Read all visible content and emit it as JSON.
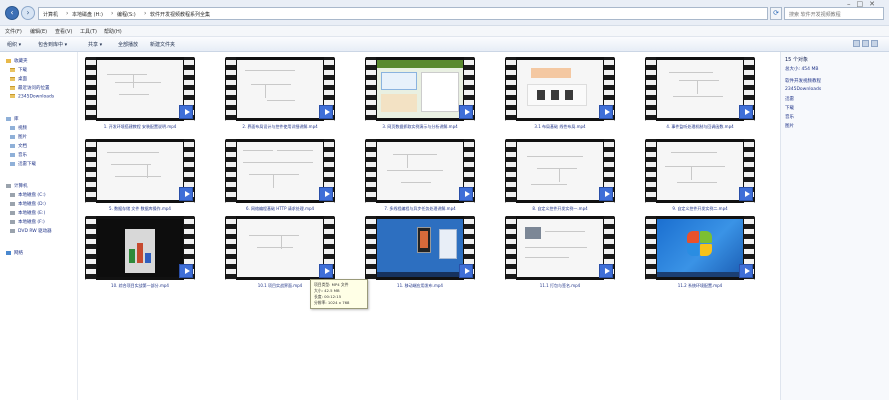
{
  "window": {
    "controls": [
      "–",
      "□",
      "✕"
    ]
  },
  "address": {
    "crumbs": [
      "计算机",
      "本地磁盘 (H:)",
      "编程(S:)",
      "软件开发视频教程系列全集"
    ],
    "search_placeholder": "搜索 软件开发视频教程"
  },
  "menu": {
    "items": [
      "文件(F)",
      "编辑(E)",
      "查看(V)",
      "工具(T)",
      "帮助(H)"
    ]
  },
  "toolbar": {
    "items": [
      "组织 ▾",
      "包含到库中 ▾",
      "共享 ▾",
      "全部播放",
      "新建文件夹"
    ]
  },
  "nav": {
    "favorites": {
      "label": "收藏夹",
      "items": [
        "下载",
        "桌面",
        "最近访问的位置",
        "2345Downloads"
      ]
    },
    "libraries": {
      "label": "库",
      "items": [
        "视频",
        "图片",
        "文档",
        "音乐",
        "迅雷下载"
      ]
    },
    "computer": {
      "label": "计算机",
      "items": [
        "本地磁盘 (C:)",
        "本地磁盘 (D:)",
        "本地磁盘 (E:)",
        "本地磁盘 (F:)",
        "DVD RW 驱动器"
      ]
    },
    "network": {
      "label": "网络"
    }
  },
  "files": [
    {
      "label": "1. 开发环境搭建教程 安装配置说明.mp4",
      "frame": "light"
    },
    {
      "label": "2. 界面布局设计与控件使用详细讲解.mp4",
      "frame": "light"
    },
    {
      "label": "3. 网页数据抓取实例演示与分析讲解.mp4",
      "frame": "web"
    },
    {
      "label": "3.1 布局基础 线性布局.mp4",
      "frame": "light"
    },
    {
      "label": "4. 事件监听处理机制与回调函数.mp4",
      "frame": "light"
    },
    {
      "label": "5. 数据存储 文件 数据库操作.mp4",
      "frame": "light"
    },
    {
      "label": "6. 网络编程基础 HTTP 请求处理.mp4",
      "frame": "light"
    },
    {
      "label": "7. 多线程编程与异步任务处理讲解.mp4",
      "frame": "light"
    },
    {
      "label": "8. 自定义控件开发实例一.mp4",
      "frame": "light"
    },
    {
      "label": "9. 自定义控件开发实例二.mp4",
      "frame": "light"
    },
    {
      "label": "10. 综合项目实战第一部分.mp4",
      "frame": "dark"
    },
    {
      "label": "10.1 项目实战界面.mp4",
      "frame": "light"
    },
    {
      "label": "11. 移动端应用发布.mp4",
      "frame": "blue"
    },
    {
      "label": "11.1 打包与签名.mp4",
      "frame": "light"
    },
    {
      "label": "11.2 系统环境配置.mp4",
      "frame": "win7"
    }
  ],
  "tooltip": {
    "lines": [
      "项目类型: MP4 文件",
      "大小: 42.5 MB",
      "长度: 00:12:15",
      "分辨率: 1024 x 768"
    ]
  },
  "details": {
    "count": "15 个对象",
    "size": "总大小: 454 MB",
    "lines": [
      "软件开发视频教程",
      "2345Downloads",
      "迅雷",
      "下载",
      "音乐",
      "图片"
    ]
  },
  "colors": {
    "accent": "#3f6fd8",
    "link_text": "#1e3287"
  }
}
